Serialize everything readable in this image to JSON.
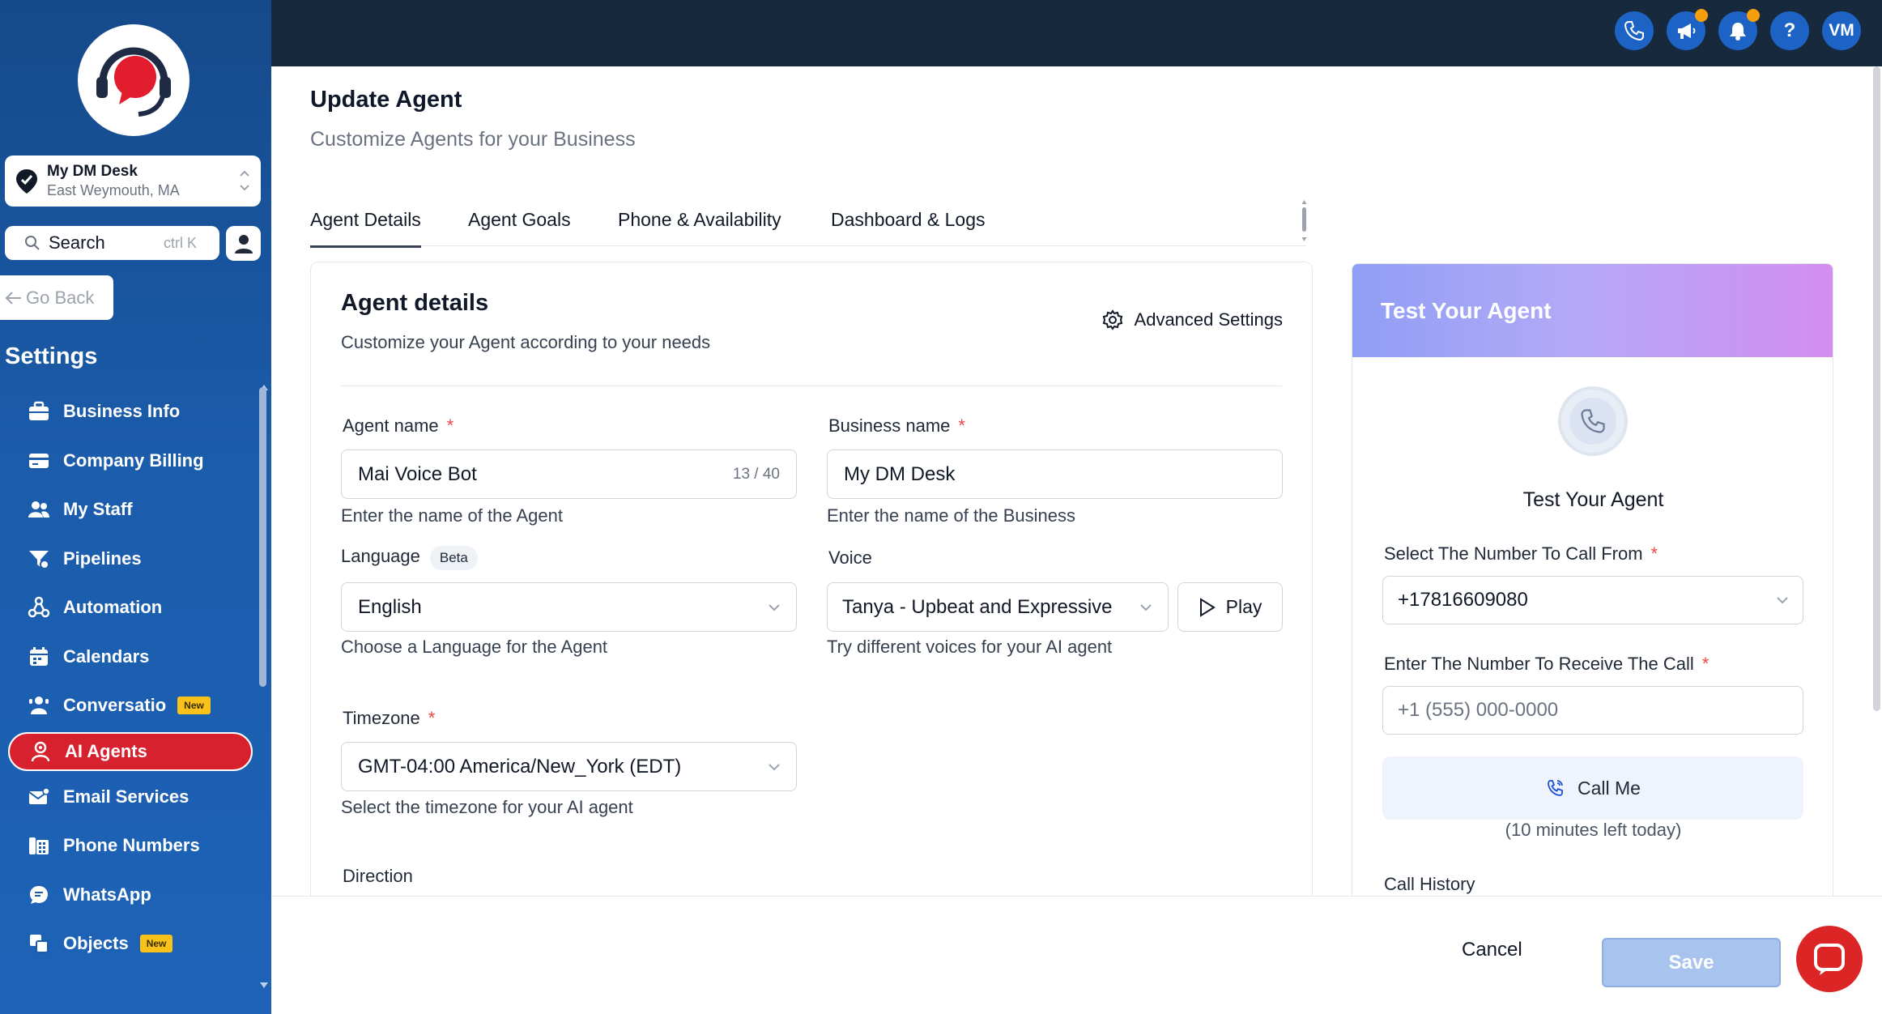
{
  "sidebar": {
    "location": {
      "name": "My DM Desk",
      "city": "East Weymouth, MA"
    },
    "search": {
      "label": "Search",
      "shortcut": "ctrl K"
    },
    "go_back": "Go Back",
    "settings_title": "Settings",
    "items": [
      {
        "label": "Business Info",
        "icon": "briefcase-icon"
      },
      {
        "label": "Company Billing",
        "icon": "credit-card-icon"
      },
      {
        "label": "My Staff",
        "icon": "users-icon"
      },
      {
        "label": "Pipelines",
        "icon": "funnel-icon"
      },
      {
        "label": "Automation",
        "icon": "workflow-icon"
      },
      {
        "label": "Calendars",
        "icon": "calendar-icon"
      },
      {
        "label": "Conversatio",
        "icon": "conversation-icon",
        "badge": "New"
      },
      {
        "label": "AI Agents",
        "icon": "ai-agent-icon",
        "active": true
      },
      {
        "label": "Email Services",
        "icon": "email-icon"
      },
      {
        "label": "Phone Numbers",
        "icon": "phone-numbers-icon"
      },
      {
        "label": "WhatsApp",
        "icon": "whatsapp-icon"
      },
      {
        "label": "Objects",
        "icon": "objects-icon",
        "badge": "New"
      }
    ]
  },
  "topbar": {
    "avatar_initials": "VM",
    "help": "?"
  },
  "page": {
    "title": "Update Agent",
    "subtitle": "Customize Agents for your Business",
    "tabs": [
      "Agent Details",
      "Agent Goals",
      "Phone & Availability",
      "Dashboard & Logs"
    ]
  },
  "agent_details": {
    "title": "Agent details",
    "subtitle": "Customize your Agent according to your needs",
    "advanced_settings": "Advanced Settings",
    "agent_name": {
      "label": "Agent name",
      "value": "Mai Voice Bot",
      "counter": "13 / 40",
      "help": "Enter the name of the Agent"
    },
    "business_name": {
      "label": "Business name",
      "value": "My DM Desk",
      "help": "Enter the name of the Business"
    },
    "language": {
      "label": "Language",
      "badge": "Beta",
      "value": "English",
      "help": "Choose a Language for the Agent"
    },
    "voice": {
      "label": "Voice",
      "value": "Tanya - Upbeat and Expressive",
      "play": "Play",
      "help": "Try different voices for your AI agent"
    },
    "timezone": {
      "label": "Timezone",
      "value": "GMT-04:00 America/New_York (EDT)",
      "help": "Select the timezone for your AI agent"
    },
    "direction": {
      "label": "Direction"
    },
    "required_mark": "*"
  },
  "test_panel": {
    "header": "Test Your Agent",
    "title": "Test Your Agent",
    "call_from": {
      "label": "Select The Number To Call From",
      "value": "+17816609080"
    },
    "receive": {
      "label": "Enter The Number To Receive The Call",
      "placeholder": "+1 (555) 000-0000"
    },
    "call_me": "Call Me",
    "minutes_left": "(10 minutes left today)",
    "call_history": "Call History"
  },
  "footer": {
    "cancel": "Cancel",
    "save": "Save"
  },
  "colors": {
    "sidebar": "#1b5cab",
    "active_item": "#d8212f",
    "topbar": "#17293d",
    "save": "#a7c3ee",
    "chat": "#dc2626"
  }
}
